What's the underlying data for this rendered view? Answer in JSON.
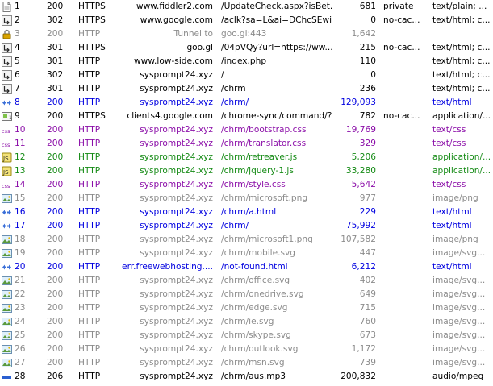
{
  "colors": {
    "black": "#000000",
    "gray": "#8c8c8c",
    "blue": "#0000e0",
    "purple": "#8b0ea8",
    "green": "#148a14"
  },
  "sessions": [
    {
      "num": "1",
      "result": "200",
      "protocol": "HTTPS",
      "host": "www.fiddler2.com",
      "url": "/UpdateCheck.aspx?isBet...",
      "body": "681",
      "caching": "private",
      "content_type": "text/plain; ...",
      "color": "black",
      "icon": "document-icon"
    },
    {
      "num": "2",
      "result": "302",
      "protocol": "HTTPS",
      "host": "www.google.com",
      "url": "/aclk?sa=L&ai=DChcSEwi...",
      "body": "0",
      "caching": "no-cac...",
      "content_type": "text/html; c...",
      "color": "black",
      "icon": "redirect-icon"
    },
    {
      "num": "3",
      "result": "200",
      "protocol": "HTTP",
      "host": "Tunnel to",
      "url": "goo.gl:443",
      "body": "1,642",
      "caching": "",
      "content_type": "",
      "color": "gray",
      "icon": "lock-icon"
    },
    {
      "num": "4",
      "result": "301",
      "protocol": "HTTPS",
      "host": "goo.gl",
      "url": "/04pVQy?url=https://ww...",
      "body": "215",
      "caching": "no-cac...",
      "content_type": "text/html; c...",
      "color": "black",
      "icon": "redirect-icon"
    },
    {
      "num": "5",
      "result": "301",
      "protocol": "HTTP",
      "host": "www.low-side.com",
      "url": "/index.php",
      "body": "110",
      "caching": "",
      "content_type": "text/html; c...",
      "color": "black",
      "icon": "redirect-icon"
    },
    {
      "num": "6",
      "result": "302",
      "protocol": "HTTP",
      "host": "sysprompt24.xyz",
      "url": "/",
      "body": "0",
      "caching": "",
      "content_type": "text/html; c...",
      "color": "black",
      "icon": "redirect-icon"
    },
    {
      "num": "7",
      "result": "301",
      "protocol": "HTTP",
      "host": "sysprompt24.xyz",
      "url": "/chrm",
      "body": "236",
      "caching": "",
      "content_type": "text/html; c...",
      "color": "black",
      "icon": "redirect-icon"
    },
    {
      "num": "8",
      "result": "200",
      "protocol": "HTTP",
      "host": "sysprompt24.xyz",
      "url": "/chrm/",
      "body": "129,093",
      "caching": "",
      "content_type": "text/html",
      "color": "blue",
      "icon": "html-icon"
    },
    {
      "num": "9",
      "result": "200",
      "protocol": "HTTPS",
      "host": "clients4.google.com",
      "url": "/chrome-sync/command/?...",
      "body": "782",
      "caching": "no-cac...",
      "content_type": "application/...",
      "color": "black",
      "icon": "binary-icon"
    },
    {
      "num": "10",
      "result": "200",
      "protocol": "HTTP",
      "host": "sysprompt24.xyz",
      "url": "/chrm/bootstrap.css",
      "body": "19,769",
      "caching": "",
      "content_type": "text/css",
      "color": "purple",
      "icon": "css-icon"
    },
    {
      "num": "11",
      "result": "200",
      "protocol": "HTTP",
      "host": "sysprompt24.xyz",
      "url": "/chrm/translator.css",
      "body": "329",
      "caching": "",
      "content_type": "text/css",
      "color": "purple",
      "icon": "css-icon"
    },
    {
      "num": "12",
      "result": "200",
      "protocol": "HTTP",
      "host": "sysprompt24.xyz",
      "url": "/chrm/retreaver.js",
      "body": "5,206",
      "caching": "",
      "content_type": "application/...",
      "color": "green",
      "icon": "script-icon"
    },
    {
      "num": "13",
      "result": "200",
      "protocol": "HTTP",
      "host": "sysprompt24.xyz",
      "url": "/chrm/jquery-1.js",
      "body": "33,280",
      "caching": "",
      "content_type": "application/...",
      "color": "green",
      "icon": "script-icon"
    },
    {
      "num": "14",
      "result": "200",
      "protocol": "HTTP",
      "host": "sysprompt24.xyz",
      "url": "/chrm/style.css",
      "body": "5,642",
      "caching": "",
      "content_type": "text/css",
      "color": "purple",
      "icon": "css-icon"
    },
    {
      "num": "15",
      "result": "200",
      "protocol": "HTTP",
      "host": "sysprompt24.xyz",
      "url": "/chrm/microsoft.png",
      "body": "977",
      "caching": "",
      "content_type": "image/png",
      "color": "gray",
      "icon": "image-icon"
    },
    {
      "num": "16",
      "result": "200",
      "protocol": "HTTP",
      "host": "sysprompt24.xyz",
      "url": "/chrm/a.html",
      "body": "229",
      "caching": "",
      "content_type": "text/html",
      "color": "blue",
      "icon": "html-icon"
    },
    {
      "num": "17",
      "result": "200",
      "protocol": "HTTP",
      "host": "sysprompt24.xyz",
      "url": "/chrm/",
      "body": "75,992",
      "caching": "",
      "content_type": "text/html",
      "color": "blue",
      "icon": "html-icon"
    },
    {
      "num": "18",
      "result": "200",
      "protocol": "HTTP",
      "host": "sysprompt24.xyz",
      "url": "/chrm/microsoft1.png",
      "body": "107,582",
      "caching": "",
      "content_type": "image/png",
      "color": "gray",
      "icon": "image-icon"
    },
    {
      "num": "19",
      "result": "200",
      "protocol": "HTTP",
      "host": "sysprompt24.xyz",
      "url": "/chrm/mobile.svg",
      "body": "447",
      "caching": "",
      "content_type": "image/svg...",
      "color": "gray",
      "icon": "image-icon"
    },
    {
      "num": "20",
      "result": "200",
      "protocol": "HTTP",
      "host": "err.freewebhosting....",
      "url": "/not-found.html",
      "body": "6,212",
      "caching": "",
      "content_type": "text/html",
      "color": "blue",
      "icon": "html-icon"
    },
    {
      "num": "21",
      "result": "200",
      "protocol": "HTTP",
      "host": "sysprompt24.xyz",
      "url": "/chrm/office.svg",
      "body": "402",
      "caching": "",
      "content_type": "image/svg...",
      "color": "gray",
      "icon": "image-icon"
    },
    {
      "num": "22",
      "result": "200",
      "protocol": "HTTP",
      "host": "sysprompt24.xyz",
      "url": "/chrm/onedrive.svg",
      "body": "649",
      "caching": "",
      "content_type": "image/svg...",
      "color": "gray",
      "icon": "image-icon"
    },
    {
      "num": "23",
      "result": "200",
      "protocol": "HTTP",
      "host": "sysprompt24.xyz",
      "url": "/chrm/edge.svg",
      "body": "715",
      "caching": "",
      "content_type": "image/svg...",
      "color": "gray",
      "icon": "image-icon"
    },
    {
      "num": "24",
      "result": "200",
      "protocol": "HTTP",
      "host": "sysprompt24.xyz",
      "url": "/chrm/ie.svg",
      "body": "760",
      "caching": "",
      "content_type": "image/svg...",
      "color": "gray",
      "icon": "image-icon"
    },
    {
      "num": "25",
      "result": "200",
      "protocol": "HTTP",
      "host": "sysprompt24.xyz",
      "url": "/chrm/skype.svg",
      "body": "673",
      "caching": "",
      "content_type": "image/svg...",
      "color": "gray",
      "icon": "image-icon"
    },
    {
      "num": "26",
      "result": "200",
      "protocol": "HTTP",
      "host": "sysprompt24.xyz",
      "url": "/chrm/outlook.svg",
      "body": "1,172",
      "caching": "",
      "content_type": "image/svg...",
      "color": "gray",
      "icon": "image-icon"
    },
    {
      "num": "27",
      "result": "200",
      "protocol": "HTTP",
      "host": "sysprompt24.xyz",
      "url": "/chrm/msn.svg",
      "body": "739",
      "caching": "",
      "content_type": "image/svg...",
      "color": "gray",
      "icon": "image-icon"
    },
    {
      "num": "28",
      "result": "206",
      "protocol": "HTTP",
      "host": "sysprompt24.xyz",
      "url": "/chrm/aus.mp3",
      "body": "200,832",
      "caching": "",
      "content_type": "audio/mpeg",
      "color": "black",
      "icon": "audio-icon"
    }
  ]
}
